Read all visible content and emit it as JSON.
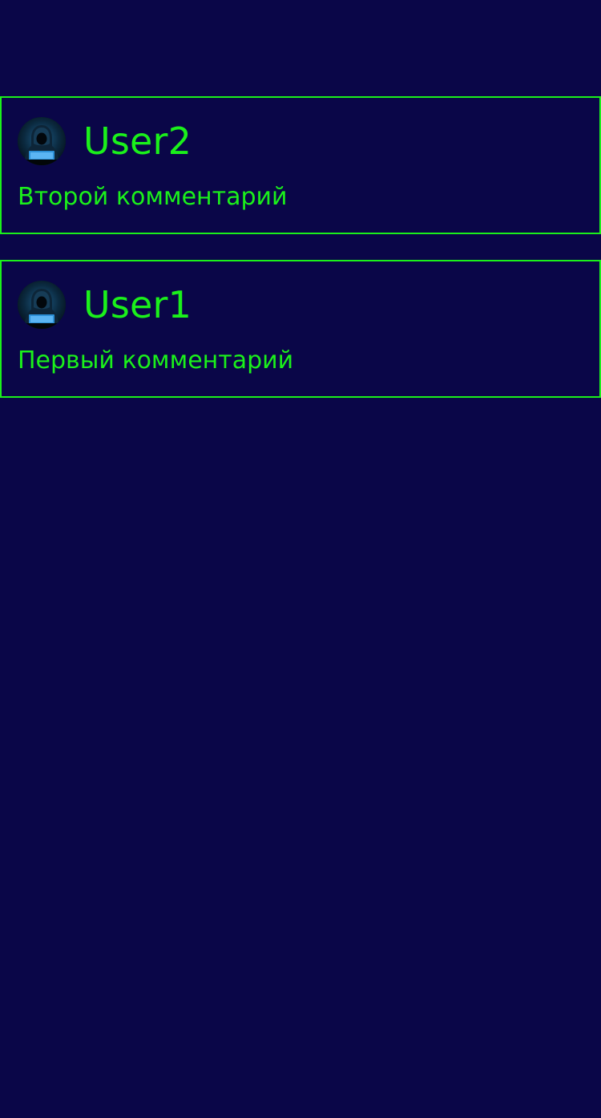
{
  "theme": {
    "background": "#0a0648",
    "accent": "#1bf01b"
  },
  "comments": [
    {
      "username": "User2",
      "text": "Второй комментарий",
      "avatar_icon": "hacker-avatar-icon"
    },
    {
      "username": "User1",
      "text": "Первый комментарий",
      "avatar_icon": "hacker-avatar-icon"
    }
  ]
}
